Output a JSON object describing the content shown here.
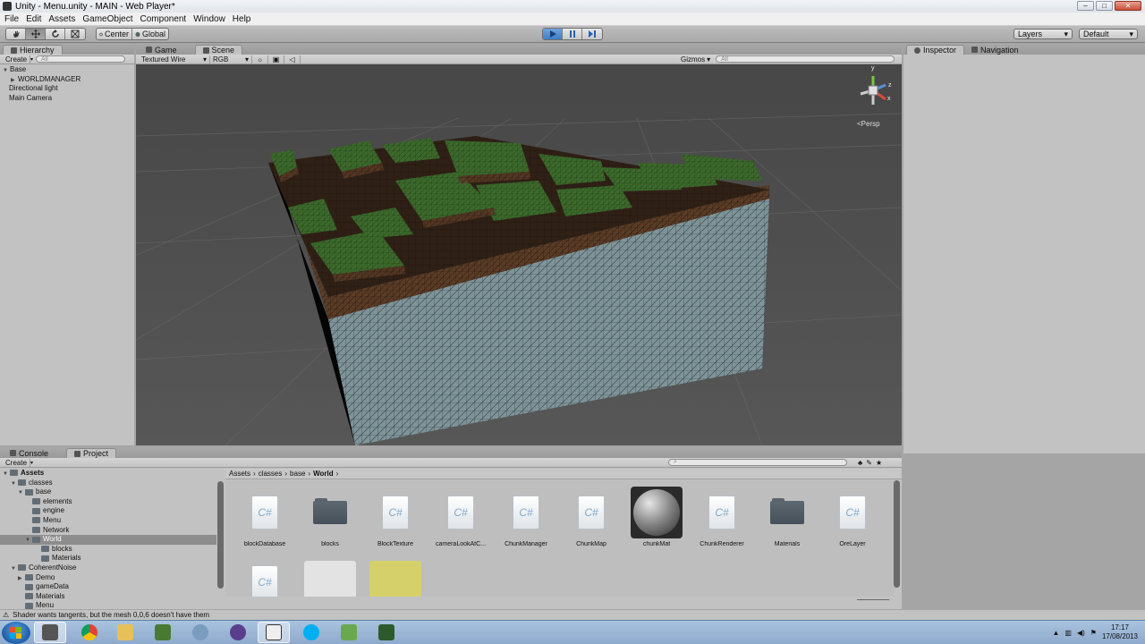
{
  "window": {
    "title": "Unity - Menu.unity - MAIN - Web Player*"
  },
  "menu": [
    "File",
    "Edit",
    "Assets",
    "GameObject",
    "Component",
    "Window",
    "Help"
  ],
  "toolbar": {
    "center_label": "Center",
    "global_label": "Global",
    "layers_label": "Layers",
    "layout_label": "Default"
  },
  "hierarchy": {
    "tab": "Hierarchy",
    "create": "Create",
    "search_placeholder": "All",
    "items": [
      "Base",
      "WORLDMANAGER",
      "Directional light",
      "Main Camera"
    ]
  },
  "scene": {
    "tab_game": "Game",
    "tab_scene": "Scene",
    "render_mode": "Textured Wire",
    "channel": "RGB",
    "gizmos": "Gizmos",
    "search_placeholder": "All",
    "gizmo_y": "y",
    "gizmo_x": "x",
    "gizmo_z": "z",
    "persp_label": "Persp"
  },
  "inspector": {
    "tab_inspector": "Inspector",
    "tab_navigation": "Navigation"
  },
  "bottom": {
    "tab_console": "Console",
    "tab_project": "Project",
    "create": "Create",
    "tree": [
      "Assets",
      "classes",
      "base",
      "elements",
      "engine",
      "Menu",
      "Network",
      "World",
      "blocks",
      "Materials",
      "CoherentNoise",
      "Demo",
      "gameData",
      "Materials",
      "Menu"
    ],
    "breadcrumb": [
      "Assets",
      "classes",
      "base",
      "World"
    ],
    "assets": [
      {
        "name": "blockDatabase",
        "kind": "cs"
      },
      {
        "name": "blocks",
        "kind": "folder"
      },
      {
        "name": "BlockTexture",
        "kind": "cs"
      },
      {
        "name": "cameraLookAtC...",
        "kind": "cs"
      },
      {
        "name": "ChunkManager",
        "kind": "cs"
      },
      {
        "name": "ChunkMap",
        "kind": "cs"
      },
      {
        "name": "chunkMat",
        "kind": "material"
      },
      {
        "name": "ChunkRenderer",
        "kind": "cs"
      },
      {
        "name": "Materials",
        "kind": "folder"
      },
      {
        "name": "OreLayer",
        "kind": "cs"
      }
    ],
    "cs_glyph": "C#"
  },
  "status": {
    "message": "Shader wants tangents, but the mesh 0,0,6 doesn't have them"
  },
  "taskbar": {
    "time": "17:17",
    "date": "17/08/2013"
  }
}
